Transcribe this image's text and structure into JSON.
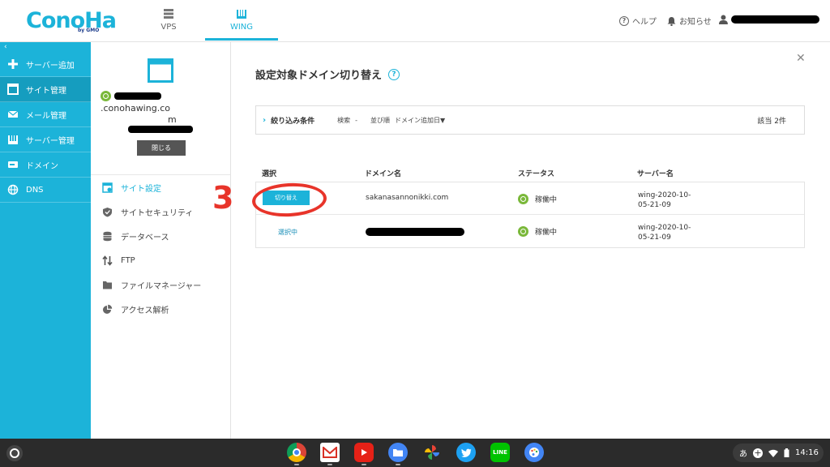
{
  "header": {
    "logo_text": "ConoHa",
    "logo_sub": "by GMO",
    "nav": [
      {
        "label": "VPS",
        "icon": "server-icon"
      },
      {
        "label": "WING",
        "icon": "wing-icon"
      }
    ],
    "help_label": "ヘルプ",
    "news_label": "お知らせ"
  },
  "sidebar": {
    "collapse_glyph": "‹",
    "items": [
      {
        "label": "サーバー追加",
        "icon": "plus-icon"
      },
      {
        "label": "サイト管理",
        "icon": "site-icon"
      },
      {
        "label": "メール管理",
        "icon": "mail-icon"
      },
      {
        "label": "サーバー管理",
        "icon": "server-manage-icon"
      },
      {
        "label": "ドメイン",
        "icon": "domain-icon"
      },
      {
        "label": "DNS",
        "icon": "globe-icon"
      }
    ]
  },
  "site_panel": {
    "domain_suffix": ".conohawing.co",
    "domain_tail": "m",
    "close_label": "閉じる",
    "menu": [
      {
        "label": "サイト設定",
        "icon": "site-settings-icon"
      },
      {
        "label": "サイトセキュリティ",
        "icon": "shield-icon"
      },
      {
        "label": "データベース",
        "icon": "database-icon"
      },
      {
        "label": "FTP",
        "icon": "ftp-icon"
      },
      {
        "label": "ファイルマネージャー",
        "icon": "folder-icon"
      },
      {
        "label": "アクセス解析",
        "icon": "pie-icon"
      }
    ]
  },
  "main": {
    "title": "設定対象ドメイン切り替え",
    "filter": {
      "toggle": "›",
      "title": "絞り込み条件",
      "search_label": "検索",
      "search_value": "-",
      "sort_label": "並び順",
      "sort_value": "ドメイン追加日▼",
      "count": "該当 2件"
    },
    "columns": [
      "選択",
      "ドメイン名",
      "ステータス",
      "サーバー名"
    ],
    "rows": [
      {
        "action": "切り替え",
        "domain": "sakanasannonikki.com",
        "status": "稼働中",
        "server": "wing-2020-10-05-21-09"
      },
      {
        "action": "選択中",
        "domain": "",
        "status": "稼働中",
        "server": "wing-2020-10-05-21-09"
      }
    ],
    "annotation_number": "3"
  },
  "shelf": {
    "tray_ime": "あ",
    "time": "14:16"
  },
  "colors": {
    "brand": "#1cb3d9",
    "sidebar_active": "#159dbf",
    "status_green": "#7ab83a",
    "annotation_red": "#e8342a"
  }
}
